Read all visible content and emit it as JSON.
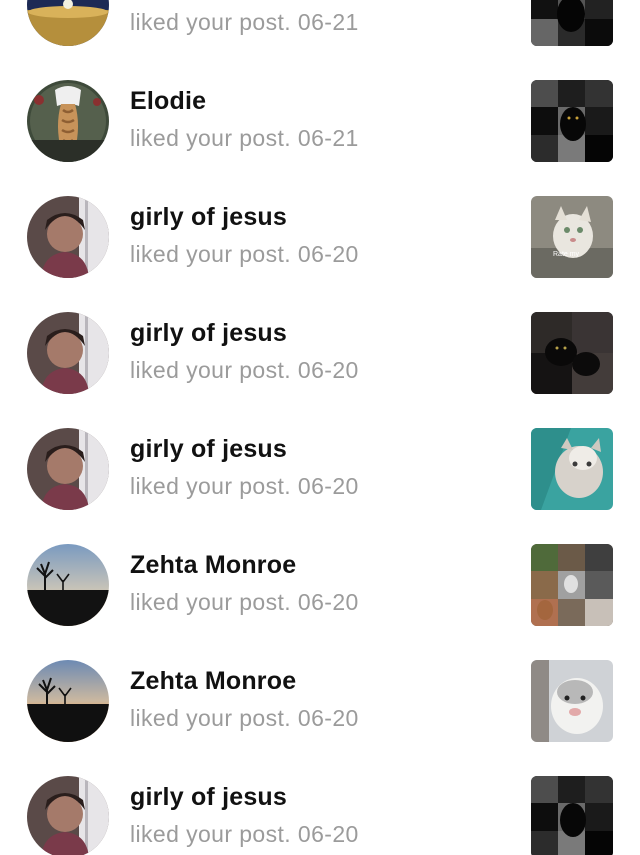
{
  "notifications": [
    {
      "name": "",
      "action": "liked your post.",
      "date": "06-21",
      "avatar": "night-sky",
      "thumb": "dark-collage"
    },
    {
      "name": "Elodie",
      "action": "liked your post.",
      "date": "06-21",
      "avatar": "braid",
      "thumb": "dark-collage"
    },
    {
      "name": "girly of jesus",
      "action": "liked your post.",
      "date": "06-20",
      "avatar": "selfie",
      "thumb": "kitten-rate"
    },
    {
      "name": "girly of jesus",
      "action": "liked your post.",
      "date": "06-20",
      "avatar": "selfie",
      "thumb": "dark-cats"
    },
    {
      "name": "girly of jesus",
      "action": "liked your post.",
      "date": "06-20",
      "avatar": "selfie",
      "thumb": "kitten-teal"
    },
    {
      "name": "Zehta Monroe",
      "action": "liked your post.",
      "date": "06-20",
      "avatar": "sunset",
      "thumb": "dogs-collage"
    },
    {
      "name": "Zehta Monroe",
      "action": "liked your post.",
      "date": "06-20",
      "avatar": "sunset",
      "thumb": "white-dog"
    },
    {
      "name": "girly of jesus",
      "action": "liked your post.",
      "date": "06-20",
      "avatar": "selfie",
      "thumb": "dark-collage"
    }
  ],
  "thumb_overlay_text": "Rate my"
}
